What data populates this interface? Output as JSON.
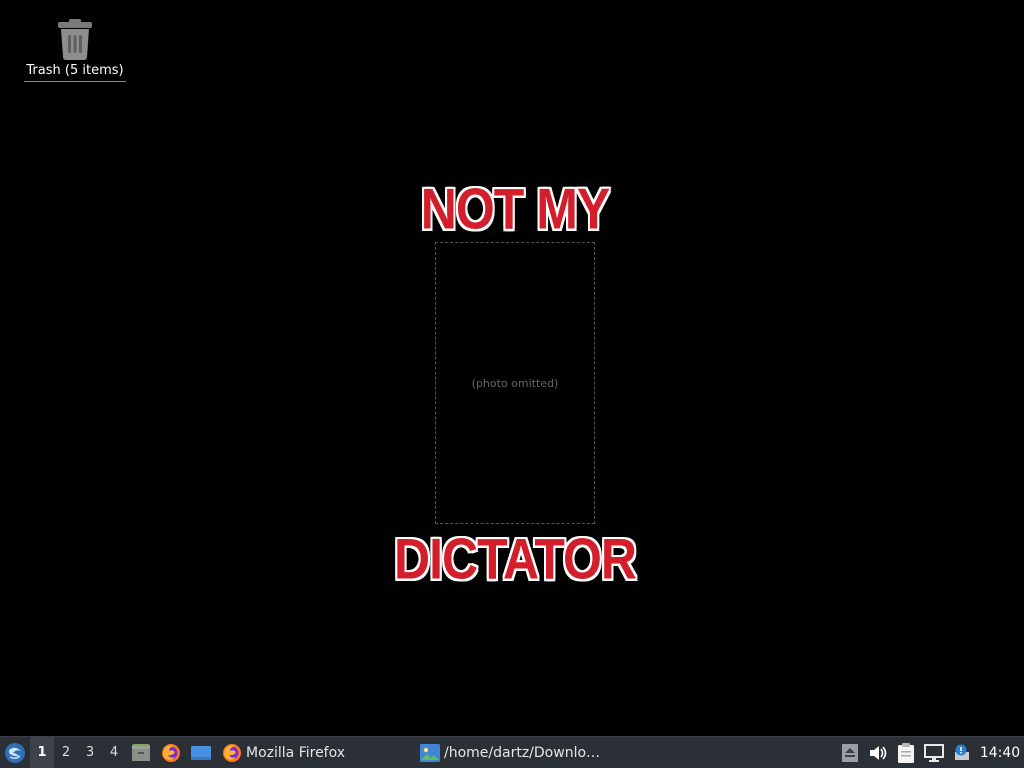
{
  "desktop": {
    "icons": [
      {
        "label": "Trash (5 items)",
        "icon": "trash-icon"
      }
    ]
  },
  "wallpaper": {
    "top_text": "NOT MY",
    "bottom_text": "DICTATOR",
    "text_color": "#d21f2b",
    "background": "#000000"
  },
  "taskbar": {
    "start_icon": "start-menu-icon",
    "workspaces": [
      "1",
      "2",
      "3",
      "4"
    ],
    "active_workspace": "1",
    "launchers": [
      "file-manager-icon",
      "firefox-icon",
      "show-desktop-icon"
    ],
    "tasks": [
      {
        "label": "Mozilla Firefox",
        "icon": "firefox-icon"
      },
      {
        "label": "/home/dartz/Downlo…",
        "icon": "image-viewer-icon"
      }
    ],
    "tray": [
      "eject-icon",
      "volume-icon",
      "clipboard-icon",
      "network-icon",
      "update-notifier-icon"
    ],
    "clock": "14:40",
    "background": "#2b2f36"
  }
}
